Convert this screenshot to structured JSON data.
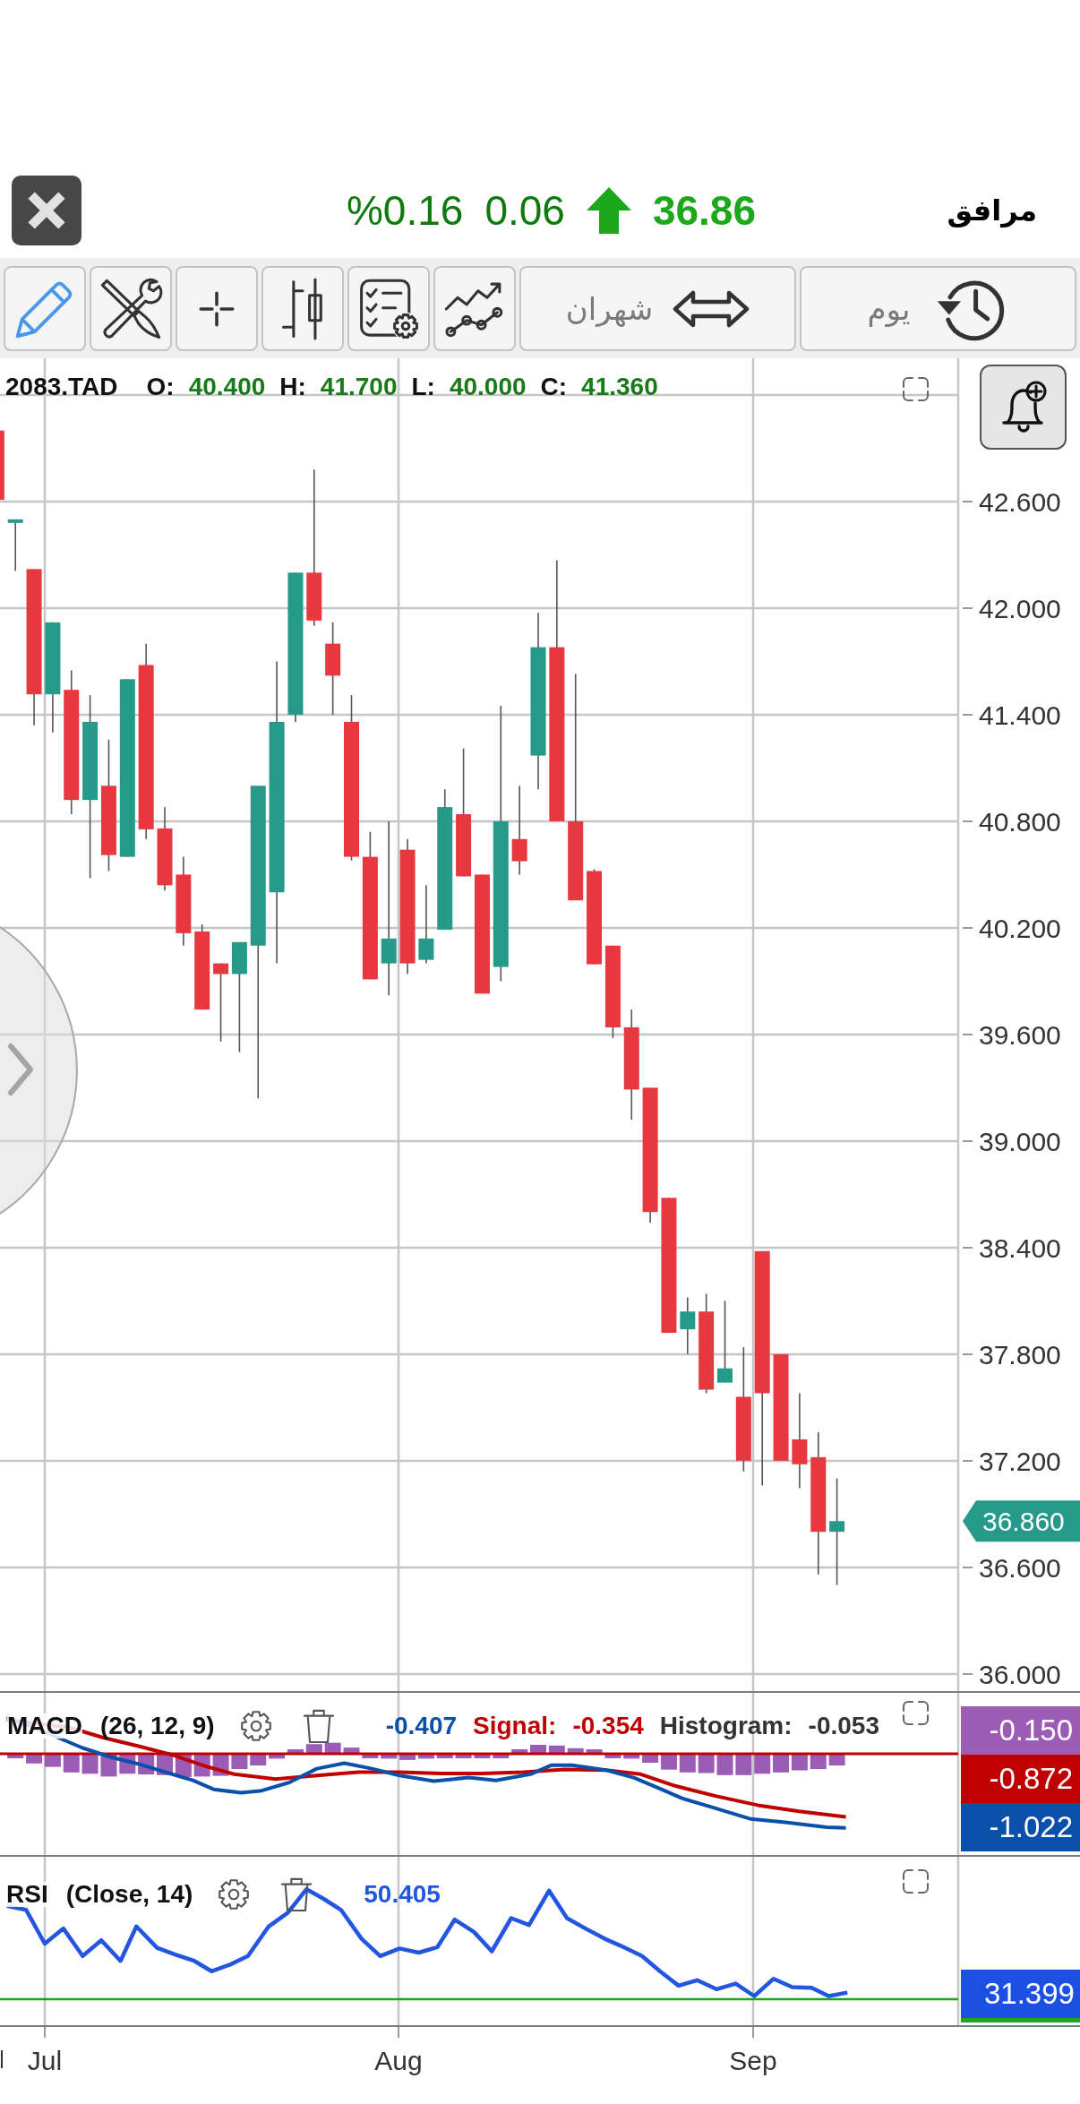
{
  "header": {
    "title": "مرافق",
    "price": "36.86",
    "rising": true,
    "change": "0.06",
    "change_percent": "%0.16"
  },
  "toolbar": {
    "interval": "يوم",
    "range": "شهران"
  },
  "main_chart": {
    "symbol": "2083.TAD",
    "ohlc": [
      {
        "label": "O:",
        "value": "40.400"
      },
      {
        "label": "H:",
        "value": "41.700"
      },
      {
        "label": "L:",
        "value": "40.000"
      },
      {
        "label": "C:",
        "value": "41.360"
      }
    ],
    "price_labels": [
      "42.600",
      "42.000",
      "41.400",
      "40.800",
      "40.200",
      "39.600",
      "39.000",
      "38.400",
      "37.800",
      "37.200",
      "36.600",
      "36.000"
    ],
    "last_price": "36.860"
  },
  "macd": {
    "title": "MACD",
    "params": "(26, 12, 9)",
    "macd_value": "-0.407",
    "signal_label": "Signal:",
    "signal_value": "-0.354",
    "histogram_label": "Histogram:",
    "histogram_value": "-0.053",
    "axis_tags": [
      {
        "text": "-0.150",
        "color": "#9c5bb5"
      },
      {
        "text": "-0.872",
        "color": "#c00000"
      },
      {
        "text": "-1.022",
        "color": "#0a50aa"
      }
    ]
  },
  "rsi": {
    "title": "RSI",
    "params": "(Close, 14)",
    "value": "50.405",
    "axis_tag": "31.399"
  },
  "x_axis": {
    "labels": [
      "Jul",
      "Aug",
      "Sep"
    ]
  }
}
